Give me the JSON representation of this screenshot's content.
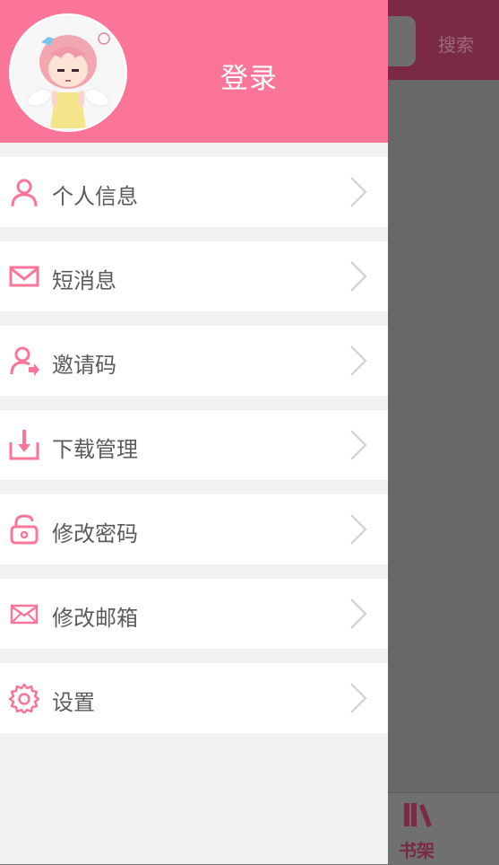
{
  "background": {
    "search_label": "搜索",
    "bottom_tab_label": "书架"
  },
  "drawer": {
    "login_label": "登录",
    "menu_items": [
      {
        "label": "个人信息",
        "icon": "person-icon"
      },
      {
        "label": "短消息",
        "icon": "mail-icon"
      },
      {
        "label": "邀请码",
        "icon": "invite-user-icon"
      },
      {
        "label": "下载管理",
        "icon": "download-icon"
      },
      {
        "label": "修改密码",
        "icon": "unlock-icon"
      },
      {
        "label": "修改邮箱",
        "icon": "envelope-icon"
      },
      {
        "label": "设置",
        "icon": "gear-icon"
      }
    ]
  },
  "colors": {
    "accent": "#fa7598",
    "text": "#5b5b5b",
    "chevron": "#cfcfcf",
    "overlay": "#6b6b6b"
  }
}
